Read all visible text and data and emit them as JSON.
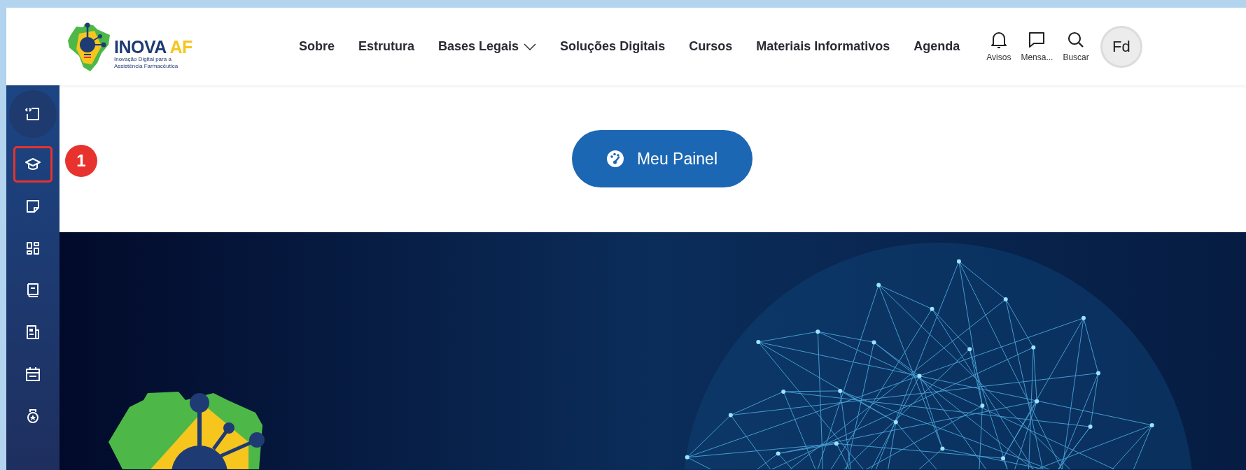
{
  "header": {
    "logo": {
      "name": "INOVA",
      "accent": "AF",
      "tagline": "Inovação Digital para a Assistência Farmacêutica"
    },
    "nav": [
      {
        "label": "Sobre",
        "has_dropdown": false
      },
      {
        "label": "Estrutura",
        "has_dropdown": false
      },
      {
        "label": "Bases Legais",
        "has_dropdown": true
      },
      {
        "label": "Soluções Digitais",
        "has_dropdown": false
      },
      {
        "label": "Cursos",
        "has_dropdown": false
      },
      {
        "label": "Materiais Informativos",
        "has_dropdown": false
      },
      {
        "label": "Agenda",
        "has_dropdown": false
      }
    ],
    "actions": [
      {
        "kind": "bell",
        "label": "Avisos"
      },
      {
        "kind": "chat",
        "label": "Mensa..."
      },
      {
        "kind": "search",
        "label": "Buscar"
      }
    ],
    "avatar": "Fd"
  },
  "sidebar": {
    "items": [
      {
        "kind": "toggle",
        "highlighted": false
      },
      {
        "kind": "cap",
        "highlighted": true
      },
      {
        "kind": "note",
        "highlighted": false
      },
      {
        "kind": "grid",
        "highlighted": false
      },
      {
        "kind": "book",
        "highlighted": false
      },
      {
        "kind": "news",
        "highlighted": false
      },
      {
        "kind": "calendar",
        "highlighted": false
      },
      {
        "kind": "medal",
        "highlighted": false
      }
    ]
  },
  "annotation": "1",
  "panel_button": "Meu Painel"
}
